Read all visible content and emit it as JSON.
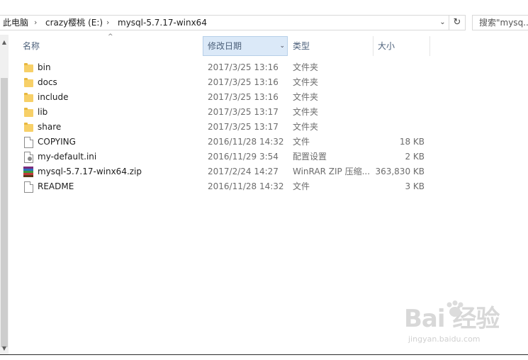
{
  "address": {
    "breadcrumbs": [
      "此电脑",
      "crazy樱桃 (E:)",
      "mysql-5.7.17-winx64"
    ],
    "search_placeholder": "搜索\"mysq..."
  },
  "columns": {
    "name": "名称",
    "date": "修改日期",
    "type": "类型",
    "size": "大小"
  },
  "files": [
    {
      "name": "bin",
      "date": "2017/3/25 13:16",
      "type": "文件夹",
      "size": "",
      "icon": "folder-icon"
    },
    {
      "name": "docs",
      "date": "2017/3/25 13:16",
      "type": "文件夹",
      "size": "",
      "icon": "folder-icon"
    },
    {
      "name": "include",
      "date": "2017/3/25 13:16",
      "type": "文件夹",
      "size": "",
      "icon": "folder-icon"
    },
    {
      "name": "lib",
      "date": "2017/3/25 13:17",
      "type": "文件夹",
      "size": "",
      "icon": "folder-icon"
    },
    {
      "name": "share",
      "date": "2017/3/25 13:17",
      "type": "文件夹",
      "size": "",
      "icon": "folder-icon"
    },
    {
      "name": "COPYING",
      "date": "2016/11/28 14:32",
      "type": "文件",
      "size": "18 KB",
      "icon": "file-icon"
    },
    {
      "name": "my-default.ini",
      "date": "2016/11/29 3:54",
      "type": "配置设置",
      "size": "2 KB",
      "icon": "ini-file-icon"
    },
    {
      "name": "mysql-5.7.17-winx64.zip",
      "date": "2017/2/24 14:27",
      "type": "WinRAR ZIP 压缩...",
      "size": "363,830 KB",
      "icon": "winrar-archive-icon"
    },
    {
      "name": "README",
      "date": "2016/11/28 14:32",
      "type": "文件",
      "size": "3 KB",
      "icon": "file-icon"
    }
  ],
  "watermark": {
    "logo_text": "Bai 经验",
    "url": "jingyan.baidu.com"
  }
}
